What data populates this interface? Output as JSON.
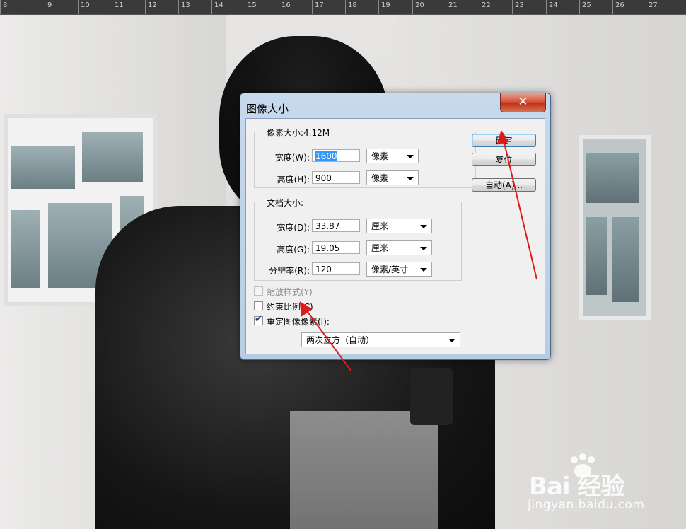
{
  "ruler": {
    "ticks": [
      "8",
      "9",
      "10",
      "11",
      "12",
      "13",
      "14",
      "15",
      "16",
      "17",
      "18",
      "19",
      "20",
      "21",
      "22",
      "23",
      "24",
      "25",
      "26",
      "27"
    ]
  },
  "dialog": {
    "title": "图像大小",
    "close_glyph": "✕",
    "pixel_dimensions": {
      "legend": "像素大小:4.12M",
      "width_label": "宽度(W):",
      "width_value": "1600",
      "width_unit": "像素",
      "height_label": "高度(H):",
      "height_value": "900",
      "height_unit": "像素"
    },
    "document_size": {
      "legend": "文档大小:",
      "width_label": "宽度(D):",
      "width_value": "33.87",
      "width_unit": "厘米",
      "height_label": "高度(G):",
      "height_value": "19.05",
      "height_unit": "厘米",
      "resolution_label": "分辨率(R):",
      "resolution_value": "120",
      "resolution_unit": "像素/英寸"
    },
    "buttons": {
      "ok": "确定",
      "reset": "复位",
      "auto": "自动(A)..."
    },
    "options": {
      "scale_styles": "缩放样式(Y)",
      "scale_styles_checked": false,
      "constrain_proportions": "约束比例(C)",
      "constrain_proportions_checked": false,
      "resample": "重定图像像素(I):",
      "resample_checked": true,
      "resample_method": "两次立方（自动）"
    }
  },
  "watermark": {
    "logo": "Bai 经验",
    "url": "jingyan.baidu.com"
  },
  "colors": {
    "arrow": "#e0191b",
    "selection": "#3399ff"
  }
}
